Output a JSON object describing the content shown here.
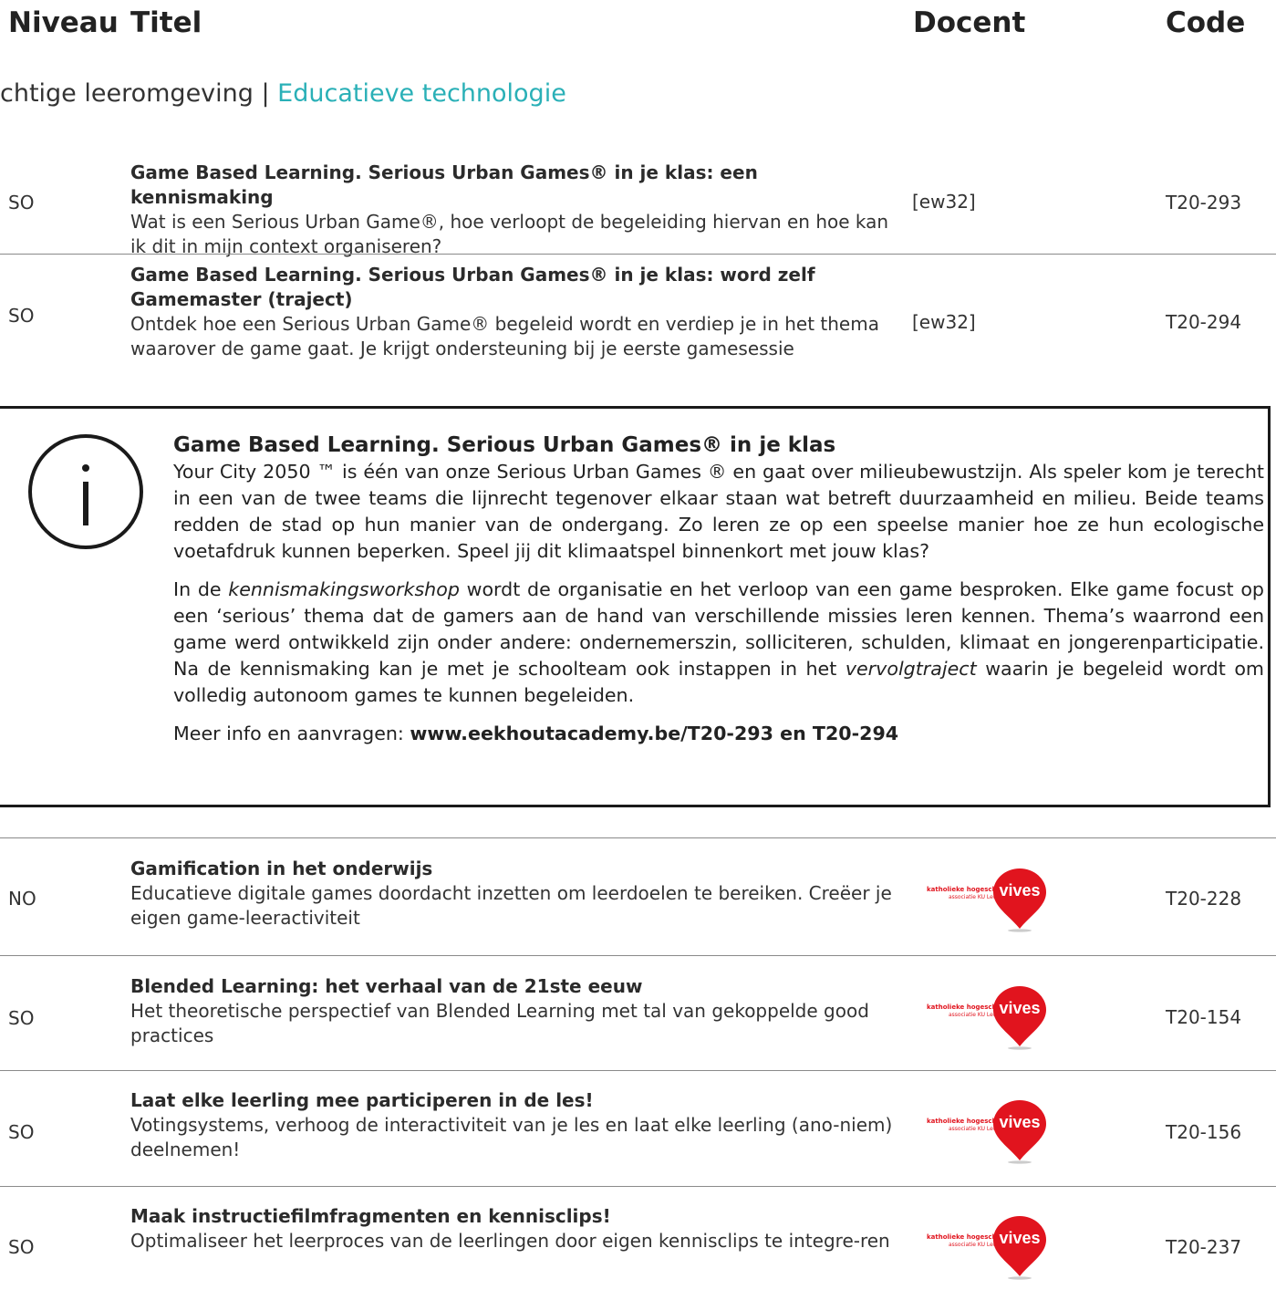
{
  "header": {
    "niveau": "Niveau",
    "titel": "Titel",
    "docent": "Docent",
    "code": "Code"
  },
  "section": {
    "category": "chtige leeromgeving | ",
    "accent": "Educatieve technologie"
  },
  "rows_top": [
    {
      "niveau": "SO",
      "title": "Game Based Learning. Serious Urban Games® in je klas: een kennismaking",
      "description": "Wat is een Serious Urban Game®, hoe verloopt de begeleiding hiervan en hoe kan ik dit in mijn context organiseren?",
      "docent": "[ew32]",
      "code": "T20-293"
    },
    {
      "niveau": "SO",
      "title": "Game Based Learning. Serious Urban Games® in je klas: word zelf Gamemaster (traject)",
      "description": "Ontdek hoe een Serious Urban Game® begeleid wordt en verdiep je in het thema waarover de game gaat. Je krijgt ondersteuning bij je eerste gamesessie",
      "docent": "[ew32]",
      "code": "T20-294"
    }
  ],
  "info_box": {
    "icon": "info-circle-icon",
    "title": "Game Based Learning. Serious Urban Games® in je klas",
    "para1": "Your City 2050 ™ is één van onze Serious Urban Games ® en gaat over milieubewustzijn. Als speler kom je terecht in een van de twee teams die lijnrecht tegenover elkaar staan wat betreft duurzaamheid en milieu. Beide teams redden de stad op hun manier van de ondergang. Zo leren ze op een speelse manier hoe ze hun ecologische voetafdruk kunnen beperken. Speel jij dit klimaatspel binnenkort met jouw klas?",
    "para2_a": "In de ",
    "para2_em1": "kennismakingsworkshop",
    "para2_b": " wordt de organisatie en het verloop van een game besproken. Elke game focust op een ‘serious’ thema dat de gamers aan de hand van verschillende missies leren kennen. Thema’s waarrond een game werd ontwikkeld zijn onder andere: ondernemerszin, solliciteren, schulden, klimaat en jongerenparticipatie. Na de kennismaking kan je met je schoolteam ook instappen in het ",
    "para2_em2": "vervolgtraject",
    "para2_c": " waarin je begeleid wordt om volledig autonoom games te kunnen begeleiden.",
    "more_label": "Meer info en aanvragen: ",
    "more_link": "www.eekhoutacademy.be/T20-293 en T20-294"
  },
  "logo": {
    "line1": "katholieke hogeschool",
    "line2": "associatie KU Leuven",
    "name": "vives",
    "color": "#e1141e"
  },
  "rows_bottom": [
    {
      "niveau": "NO",
      "title": "Gamification in het onderwijs",
      "description": "Educatieve digitale games doordacht inzetten om leerdoelen te bereiken. Creëer je eigen game-leeractiviteit",
      "code": "T20-228"
    },
    {
      "niveau": "SO",
      "title": "Blended Learning: het verhaal van de 21ste eeuw",
      "description": "Het theoretische perspectief van Blended Learning met tal van gekoppelde good practices",
      "code": "T20-154"
    },
    {
      "niveau": "SO",
      "title": "Laat elke leerling mee participeren in de les!",
      "description": "Votingsystems, verhoog de interactiviteit van je les en laat elke leerling (ano-niem) deelnemen!",
      "code": "T20-156"
    },
    {
      "niveau": "SO",
      "title": "Maak instructiefilmfragmenten en kennisclips!",
      "description": "Optimaliseer het leerproces van de leerlingen door eigen kennisclips te integre-ren",
      "code": "T20-237"
    }
  ]
}
